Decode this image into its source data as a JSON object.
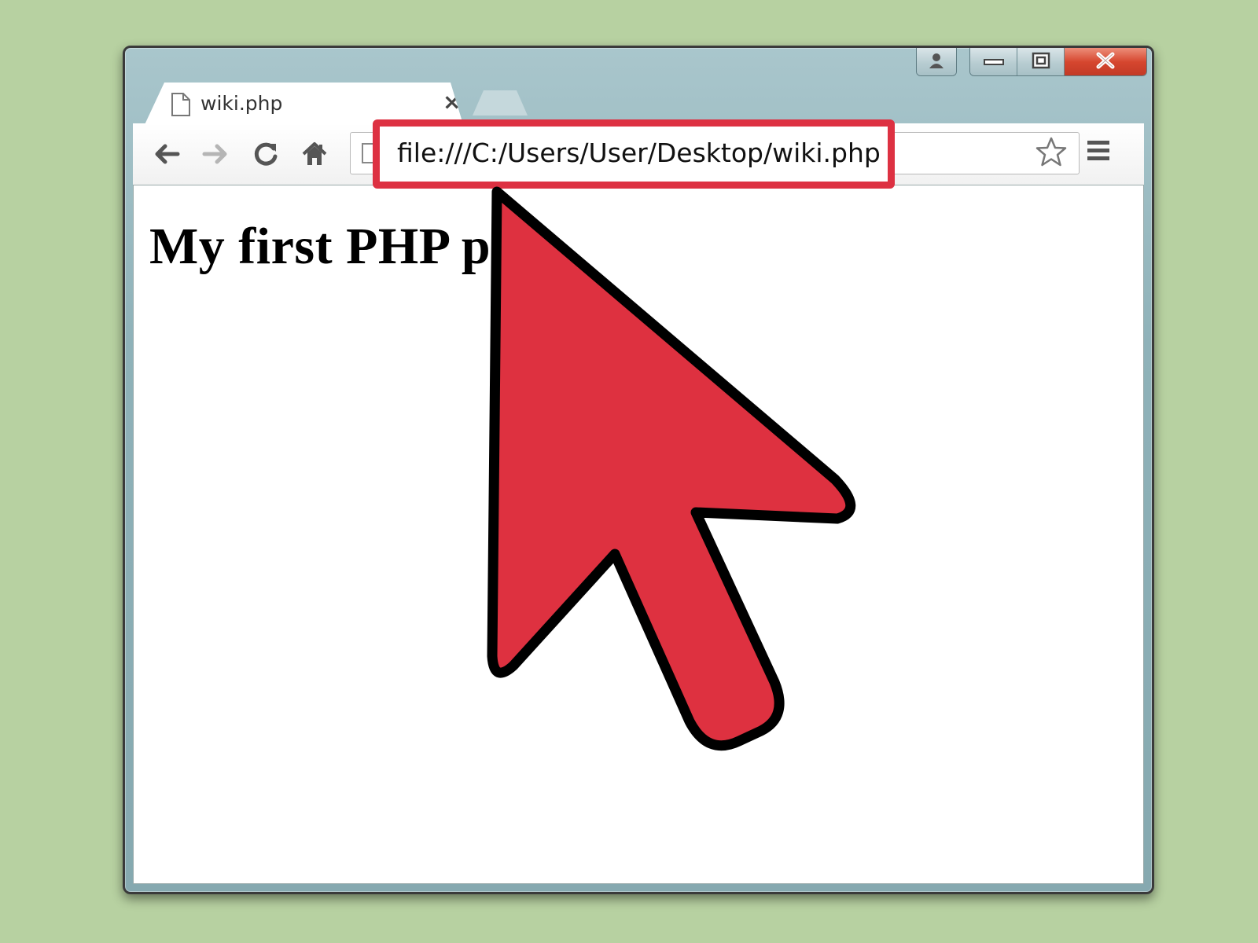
{
  "browser": {
    "tab": {
      "title": "wiki.php",
      "close_glyph": "×",
      "icon": "page-icon"
    },
    "address_bar": {
      "url": "file:///C:/Users/User/Desktop/wiki.php"
    },
    "toolbar_icons": [
      "back-icon",
      "forward-icon",
      "reload-icon",
      "home-icon",
      "star-icon",
      "menu-icon"
    ],
    "window_controls": [
      "user-icon",
      "minimize-icon",
      "maximize-icon",
      "close-icon"
    ]
  },
  "page": {
    "heading": "My first PHP page"
  },
  "annotation": {
    "highlight_color": "#dd3142",
    "cursor_color": "#de3140"
  },
  "background_color": "#b7d1a1"
}
